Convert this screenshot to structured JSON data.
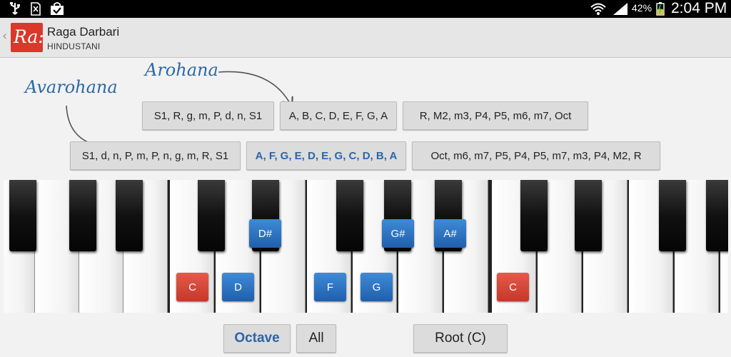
{
  "status_bar": {
    "battery_text": "42%",
    "time": "2:04 PM",
    "icons": [
      "usb-icon",
      "sd-card-icon",
      "shopping-bag-icon",
      "wifi-icon",
      "signal-icon",
      "battery-icon"
    ]
  },
  "action_bar": {
    "logo_text": "Ra:",
    "title": "Raga Darbari",
    "subtitle": "HINDUSTANI"
  },
  "annotations": {
    "arohana": "Arohana",
    "avarohana": "Avarohana",
    "color": "#2d69a8"
  },
  "scales": {
    "arohana": [
      "S1, R, g, m, P, d, n, S1",
      "A, B, C, D, E, F, G, A",
      "R, M2, m3, P4, P5, m6, m7, Oct"
    ],
    "avarohana": [
      "S1, d, n, P, m, P, n, g, m, R, S1",
      "A, F, G, E, D, E, G, C, D, B, A",
      "Oct, m6, m7, P5, P4, P5, m7, m3, P4, M2, R"
    ],
    "active_index": 1
  },
  "piano": {
    "notes": [
      {
        "label": "C",
        "color": "red"
      },
      {
        "label": "D",
        "color": "blue"
      },
      {
        "label": "D#",
        "color": "blue"
      },
      {
        "label": "F",
        "color": "blue"
      },
      {
        "label": "G",
        "color": "blue"
      },
      {
        "label": "G#",
        "color": "blue"
      },
      {
        "label": "A#",
        "color": "blue"
      },
      {
        "label": "C",
        "color": "red"
      }
    ],
    "colors": {
      "blue": "#2a72c4",
      "red": "#d9463a"
    }
  },
  "controls": {
    "octave": "Octave",
    "all": "All",
    "root": "Root (C)"
  }
}
